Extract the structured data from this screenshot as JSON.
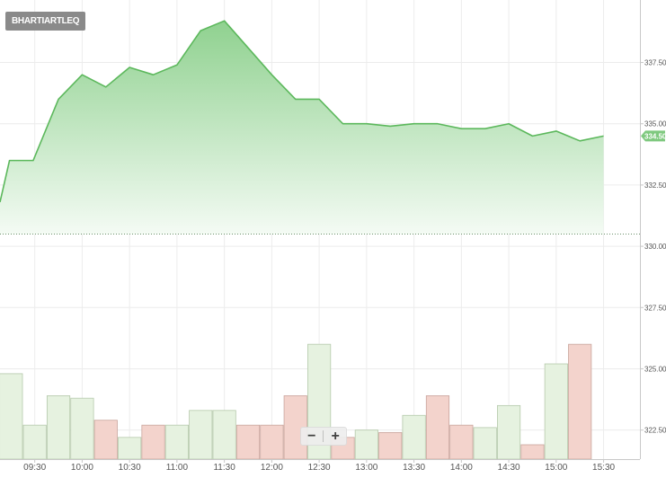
{
  "symbol": "BHARTIARTLEQ",
  "zoom": {
    "minus_label": "−",
    "plus_label": "+"
  },
  "colors": {
    "price_line": "#5cb85c",
    "area_top": "#8fd18f",
    "area_bottom": "#f4fbf4",
    "up_fill": "#e6f2e0",
    "up_stroke": "#b5c9ab",
    "down_fill": "#f3d3cc",
    "down_stroke": "#c9a49c",
    "grid": "#ececec",
    "axis_text": "#555555",
    "last_price_badge": "#7fc97f"
  },
  "chart_data": {
    "type": "area",
    "grid": true,
    "price_axis": {
      "ticks": [
        "337.50",
        "335.00",
        "332.50",
        "330.00",
        "327.50",
        "325.00",
        "322.50"
      ],
      "tick_values": [
        337.5,
        335.0,
        332.5,
        330.0,
        327.5,
        325.0,
        322.5
      ],
      "range": [
        321.9,
        339.5
      ],
      "last_price_label": "334.50",
      "last_price": 334.5,
      "reference_price": 330.5
    },
    "time_axis": {
      "tick_labels": [
        "09:30",
        "10:00",
        "10:30",
        "11:00",
        "11:30",
        "12:00",
        "12:30",
        "13:00",
        "13:30",
        "14:00",
        "14:30",
        "15:00",
        "15:30"
      ],
      "tick_minutes": [
        570,
        600,
        630,
        660,
        690,
        720,
        750,
        780,
        810,
        840,
        870,
        900,
        930
      ],
      "range_minutes": [
        548,
        953
      ]
    },
    "price_series": {
      "x_minutes": [
        548,
        554,
        569,
        585,
        600,
        615,
        630,
        645,
        660,
        675,
        690,
        705,
        720,
        735,
        750,
        765,
        780,
        795,
        810,
        825,
        840,
        855,
        870,
        885,
        900,
        915,
        930
      ],
      "y": [
        331.8,
        333.5,
        333.5,
        336.0,
        337.0,
        336.5,
        337.3,
        337.0,
        337.4,
        338.8,
        339.2,
        338.1,
        337.0,
        336.0,
        336.0,
        335.0,
        335.0,
        334.9,
        335.0,
        335.0,
        334.8,
        334.8,
        335.0,
        334.5,
        334.7,
        334.3,
        334.5
      ]
    },
    "volume_series": {
      "bars": [
        {
          "minute": 555,
          "top": 324.8,
          "dir": "up"
        },
        {
          "minute": 570,
          "top": 322.7,
          "dir": "up"
        },
        {
          "minute": 585,
          "top": 323.9,
          "dir": "up"
        },
        {
          "minute": 600,
          "top": 323.8,
          "dir": "up"
        },
        {
          "minute": 615,
          "top": 322.9,
          "dir": "down"
        },
        {
          "minute": 630,
          "top": 322.2,
          "dir": "up"
        },
        {
          "minute": 645,
          "top": 322.7,
          "dir": "down"
        },
        {
          "minute": 660,
          "top": 322.7,
          "dir": "up"
        },
        {
          "minute": 675,
          "top": 323.3,
          "dir": "up"
        },
        {
          "minute": 690,
          "top": 323.3,
          "dir": "up"
        },
        {
          "minute": 705,
          "top": 322.7,
          "dir": "down"
        },
        {
          "minute": 720,
          "top": 322.7,
          "dir": "down"
        },
        {
          "minute": 735,
          "top": 323.9,
          "dir": "down"
        },
        {
          "minute": 750,
          "top": 326.0,
          "dir": "up"
        },
        {
          "minute": 765,
          "top": 322.2,
          "dir": "down"
        },
        {
          "minute": 780,
          "top": 322.5,
          "dir": "up"
        },
        {
          "minute": 795,
          "top": 322.4,
          "dir": "down"
        },
        {
          "minute": 810,
          "top": 323.1,
          "dir": "up"
        },
        {
          "minute": 825,
          "top": 323.9,
          "dir": "down"
        },
        {
          "minute": 840,
          "top": 322.7,
          "dir": "down"
        },
        {
          "minute": 855,
          "top": 322.6,
          "dir": "up"
        },
        {
          "minute": 870,
          "top": 323.5,
          "dir": "up"
        },
        {
          "minute": 885,
          "top": 321.9,
          "dir": "down"
        },
        {
          "minute": 900,
          "top": 325.2,
          "dir": "up"
        },
        {
          "minute": 915,
          "top": 326.0,
          "dir": "down"
        }
      ]
    }
  }
}
